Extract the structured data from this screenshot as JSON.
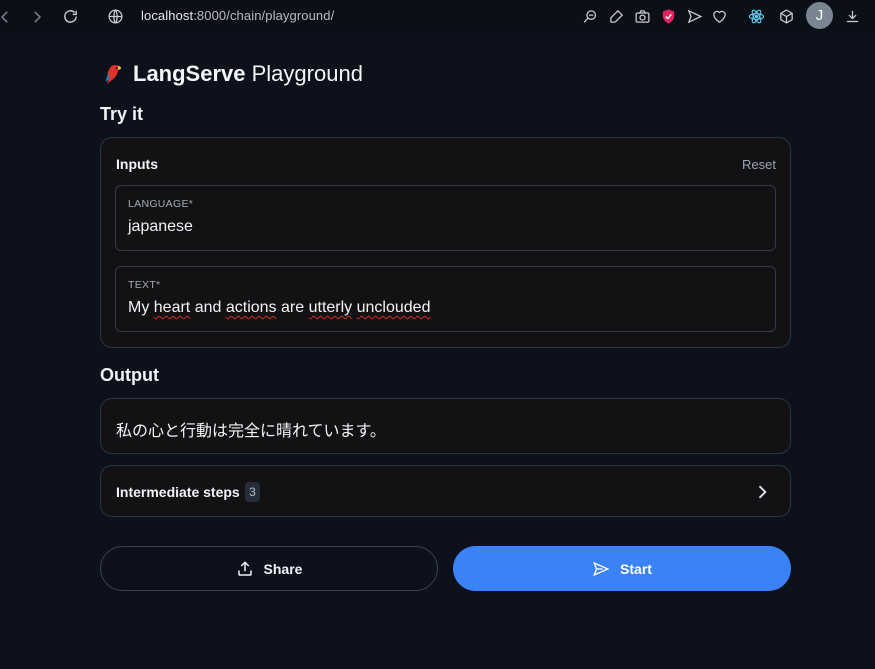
{
  "browser": {
    "url_host": "localhost",
    "url_rest": ":8000/chain/playground/",
    "avatar_letter": "J"
  },
  "header": {
    "brand_bold": "LangServe",
    "brand_rest": "Playground"
  },
  "try_it": {
    "title": "Try it",
    "inputs_title": "Inputs",
    "reset_label": "Reset",
    "fields": [
      {
        "label": "LANGUAGE*",
        "value": "japanese"
      },
      {
        "label": "TEXT*",
        "value": "My heart and actions are utterly unclouded"
      }
    ]
  },
  "output": {
    "title": "Output",
    "text": "私の心と行動は完全に晴れています。",
    "steps_label": "Intermediate steps",
    "steps_count": "3"
  },
  "actions": {
    "share_label": "Share",
    "start_label": "Start"
  },
  "colors": {
    "background": "#0c111b",
    "accent": "#3b82f6"
  }
}
